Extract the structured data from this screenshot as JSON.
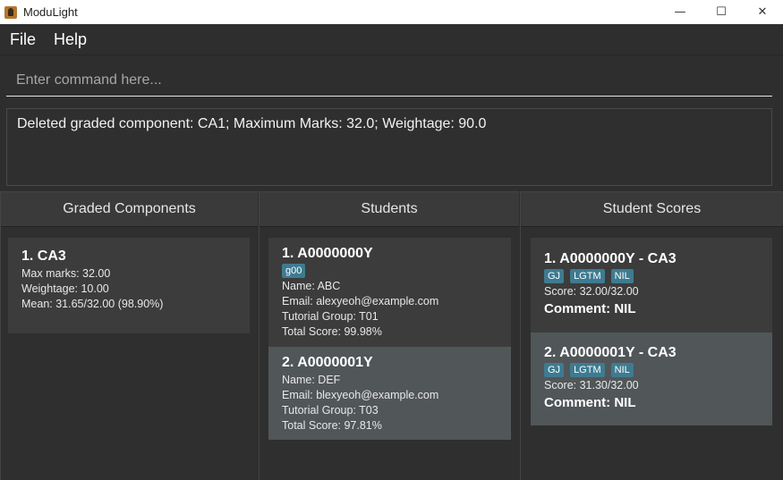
{
  "window": {
    "title": "ModuLight",
    "minimize": "—",
    "maximize": "☐",
    "close": "✕"
  },
  "menu": {
    "file": "File",
    "help": "Help"
  },
  "command": {
    "placeholder": "Enter command here..."
  },
  "result": {
    "text": "Deleted graded component: CA1; Maximum Marks: 32.0; Weightage: 90.0"
  },
  "panels": {
    "graded_components": {
      "header": "Graded Components",
      "items": [
        {
          "title": "1.  CA3",
          "max_marks": "Max marks: 32.00",
          "weightage": "Weightage: 10.00",
          "mean": "Mean: 31.65/32.00 (98.90%)"
        }
      ]
    },
    "students": {
      "header": "Students",
      "items": [
        {
          "title": "1.  A0000000Y",
          "tag": "g00",
          "name": "Name: ABC",
          "email": "Email: alexyeoh@example.com",
          "tutorial": "Tutorial Group: T01",
          "total": "Total Score: 99.98%"
        },
        {
          "title": "2.  A0000001Y",
          "name": "Name: DEF",
          "email": "Email: blexyeoh@example.com",
          "tutorial": "Tutorial Group: T03",
          "total": "Total Score: 97.81%"
        }
      ]
    },
    "student_scores": {
      "header": "Student Scores",
      "items": [
        {
          "title": "1.  A0000000Y - CA3",
          "tags": [
            "GJ",
            "LGTM",
            "NIL"
          ],
          "score": "Score: 32.00/32.00",
          "comment": "Comment: NIL"
        },
        {
          "title": "2.  A0000001Y - CA3",
          "tags": [
            "GJ",
            "LGTM",
            "NIL"
          ],
          "score": "Score: 31.30/32.00",
          "comment": "Comment: NIL"
        }
      ]
    }
  }
}
